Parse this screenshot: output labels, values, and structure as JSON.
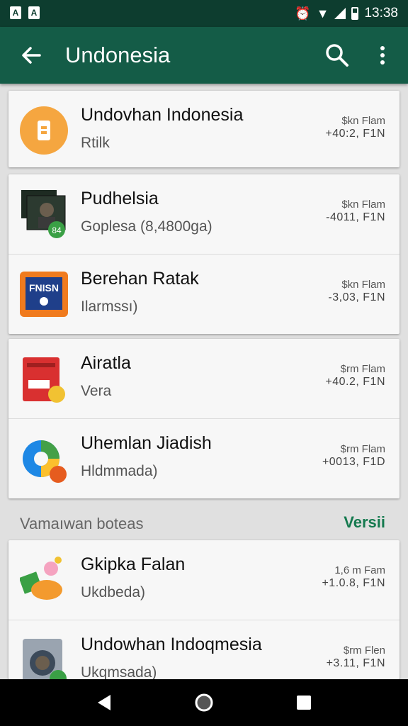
{
  "status_bar": {
    "time": "13:38"
  },
  "app_bar": {
    "title": "Undonesia"
  },
  "cards": [
    {
      "rows": [
        {
          "name": "Undovhan Indonesia",
          "sub": "Rtilk",
          "meta1": "$kn Flam",
          "meta2": "+40:2, F1N",
          "icon": "phone-icon"
        }
      ]
    },
    {
      "rows": [
        {
          "name": "Pudhelsia",
          "sub": "Goplesa (8,4800ga)",
          "meta1": "$kn Flam",
          "meta2": "-4011, F1N",
          "icon": "media-icon"
        },
        {
          "name": "Berehan Ratak",
          "sub": "Ilarmssı)",
          "meta1": "$kn Flam",
          "meta2": "-3,03, F1N",
          "icon": "tv-icon"
        }
      ]
    },
    {
      "rows": [
        {
          "name": "Airatla",
          "sub": "Vera",
          "meta1": "$rm Flam",
          "meta2": "+40.2, F1N",
          "icon": "box-icon"
        },
        {
          "name": "Uhemlan Jiadish",
          "sub": "Hldmmada)",
          "meta1": "$rm Flam",
          "meta2": "+0013, F1D",
          "icon": "chat-icon"
        }
      ]
    }
  ],
  "section": {
    "label": "Vamaıwan boteas",
    "action": "Versii"
  },
  "cards2": [
    {
      "rows": [
        {
          "name": "Gkipka Falan",
          "sub": "Ukdbeda)",
          "meta1": "1,6 m Fam",
          "meta2": "+1.0.8, F1N",
          "icon": "character-icon"
        },
        {
          "name": "Undowhan Indoqmesia",
          "sub": "Ukqmsada)",
          "meta1": "$rm Flen",
          "meta2": "+3.11, F1N",
          "icon": "washer-icon"
        }
      ]
    }
  ]
}
